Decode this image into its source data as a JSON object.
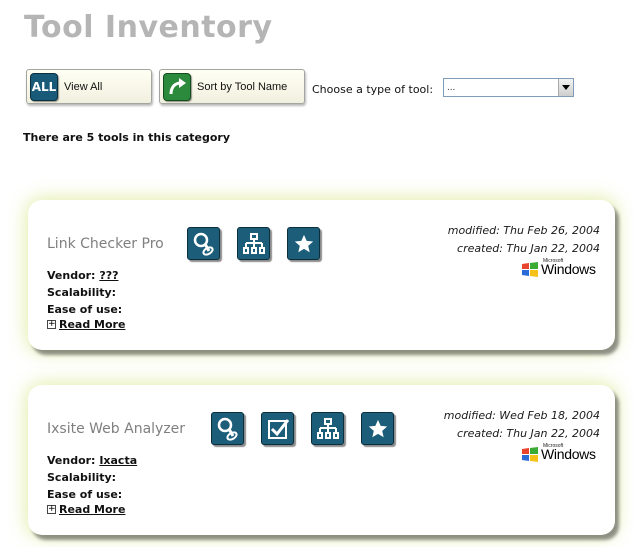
{
  "page": {
    "title": "Tool Inventory"
  },
  "toolbar": {
    "view_all": {
      "icon": "all-icon",
      "icon_text": "ALL",
      "label": "View All"
    },
    "sort": {
      "icon": "curved-arrow-icon",
      "label": "Sort by Tool Name"
    },
    "choose_label": "Choose a type of tool:",
    "select_value": "..."
  },
  "summary": {
    "count_text": "There are 5 tools in this category"
  },
  "cards": [
    {
      "name": "Link Checker Pro",
      "modified": "modified: Thu Feb 26, 2004",
      "created": "created: Thu Jan 22, 2004",
      "os_brand_small": "Microsoft",
      "os_brand": "Windows",
      "vendor_label": "Vendor:",
      "vendor_value": "???",
      "scalability_label": "Scalability:",
      "ease_label": "Ease of use:",
      "read_more": "Read More",
      "icons": [
        "link-check-icon",
        "sitemap-icon",
        "star-icon"
      ]
    },
    {
      "name": "Ixsite Web Analyzer",
      "modified": "modified: Wed Feb 18, 2004",
      "created": "created: Thu Jan 22, 2004",
      "os_brand_small": "Microsoft",
      "os_brand": "Windows",
      "vendor_label": "Vendor:",
      "vendor_value": "Ixacta",
      "scalability_label": "Scalability:",
      "ease_label": "Ease of use:",
      "read_more": "Read More",
      "icons": [
        "link-check-icon",
        "checkbox-icon",
        "sitemap-icon",
        "star-icon"
      ]
    }
  ],
  "colors": {
    "title_gray": "#b5b5b5",
    "icon_blue": "#1c5d79",
    "sort_green": "#2c8a3c",
    "card_glow": "#e1eba0"
  }
}
